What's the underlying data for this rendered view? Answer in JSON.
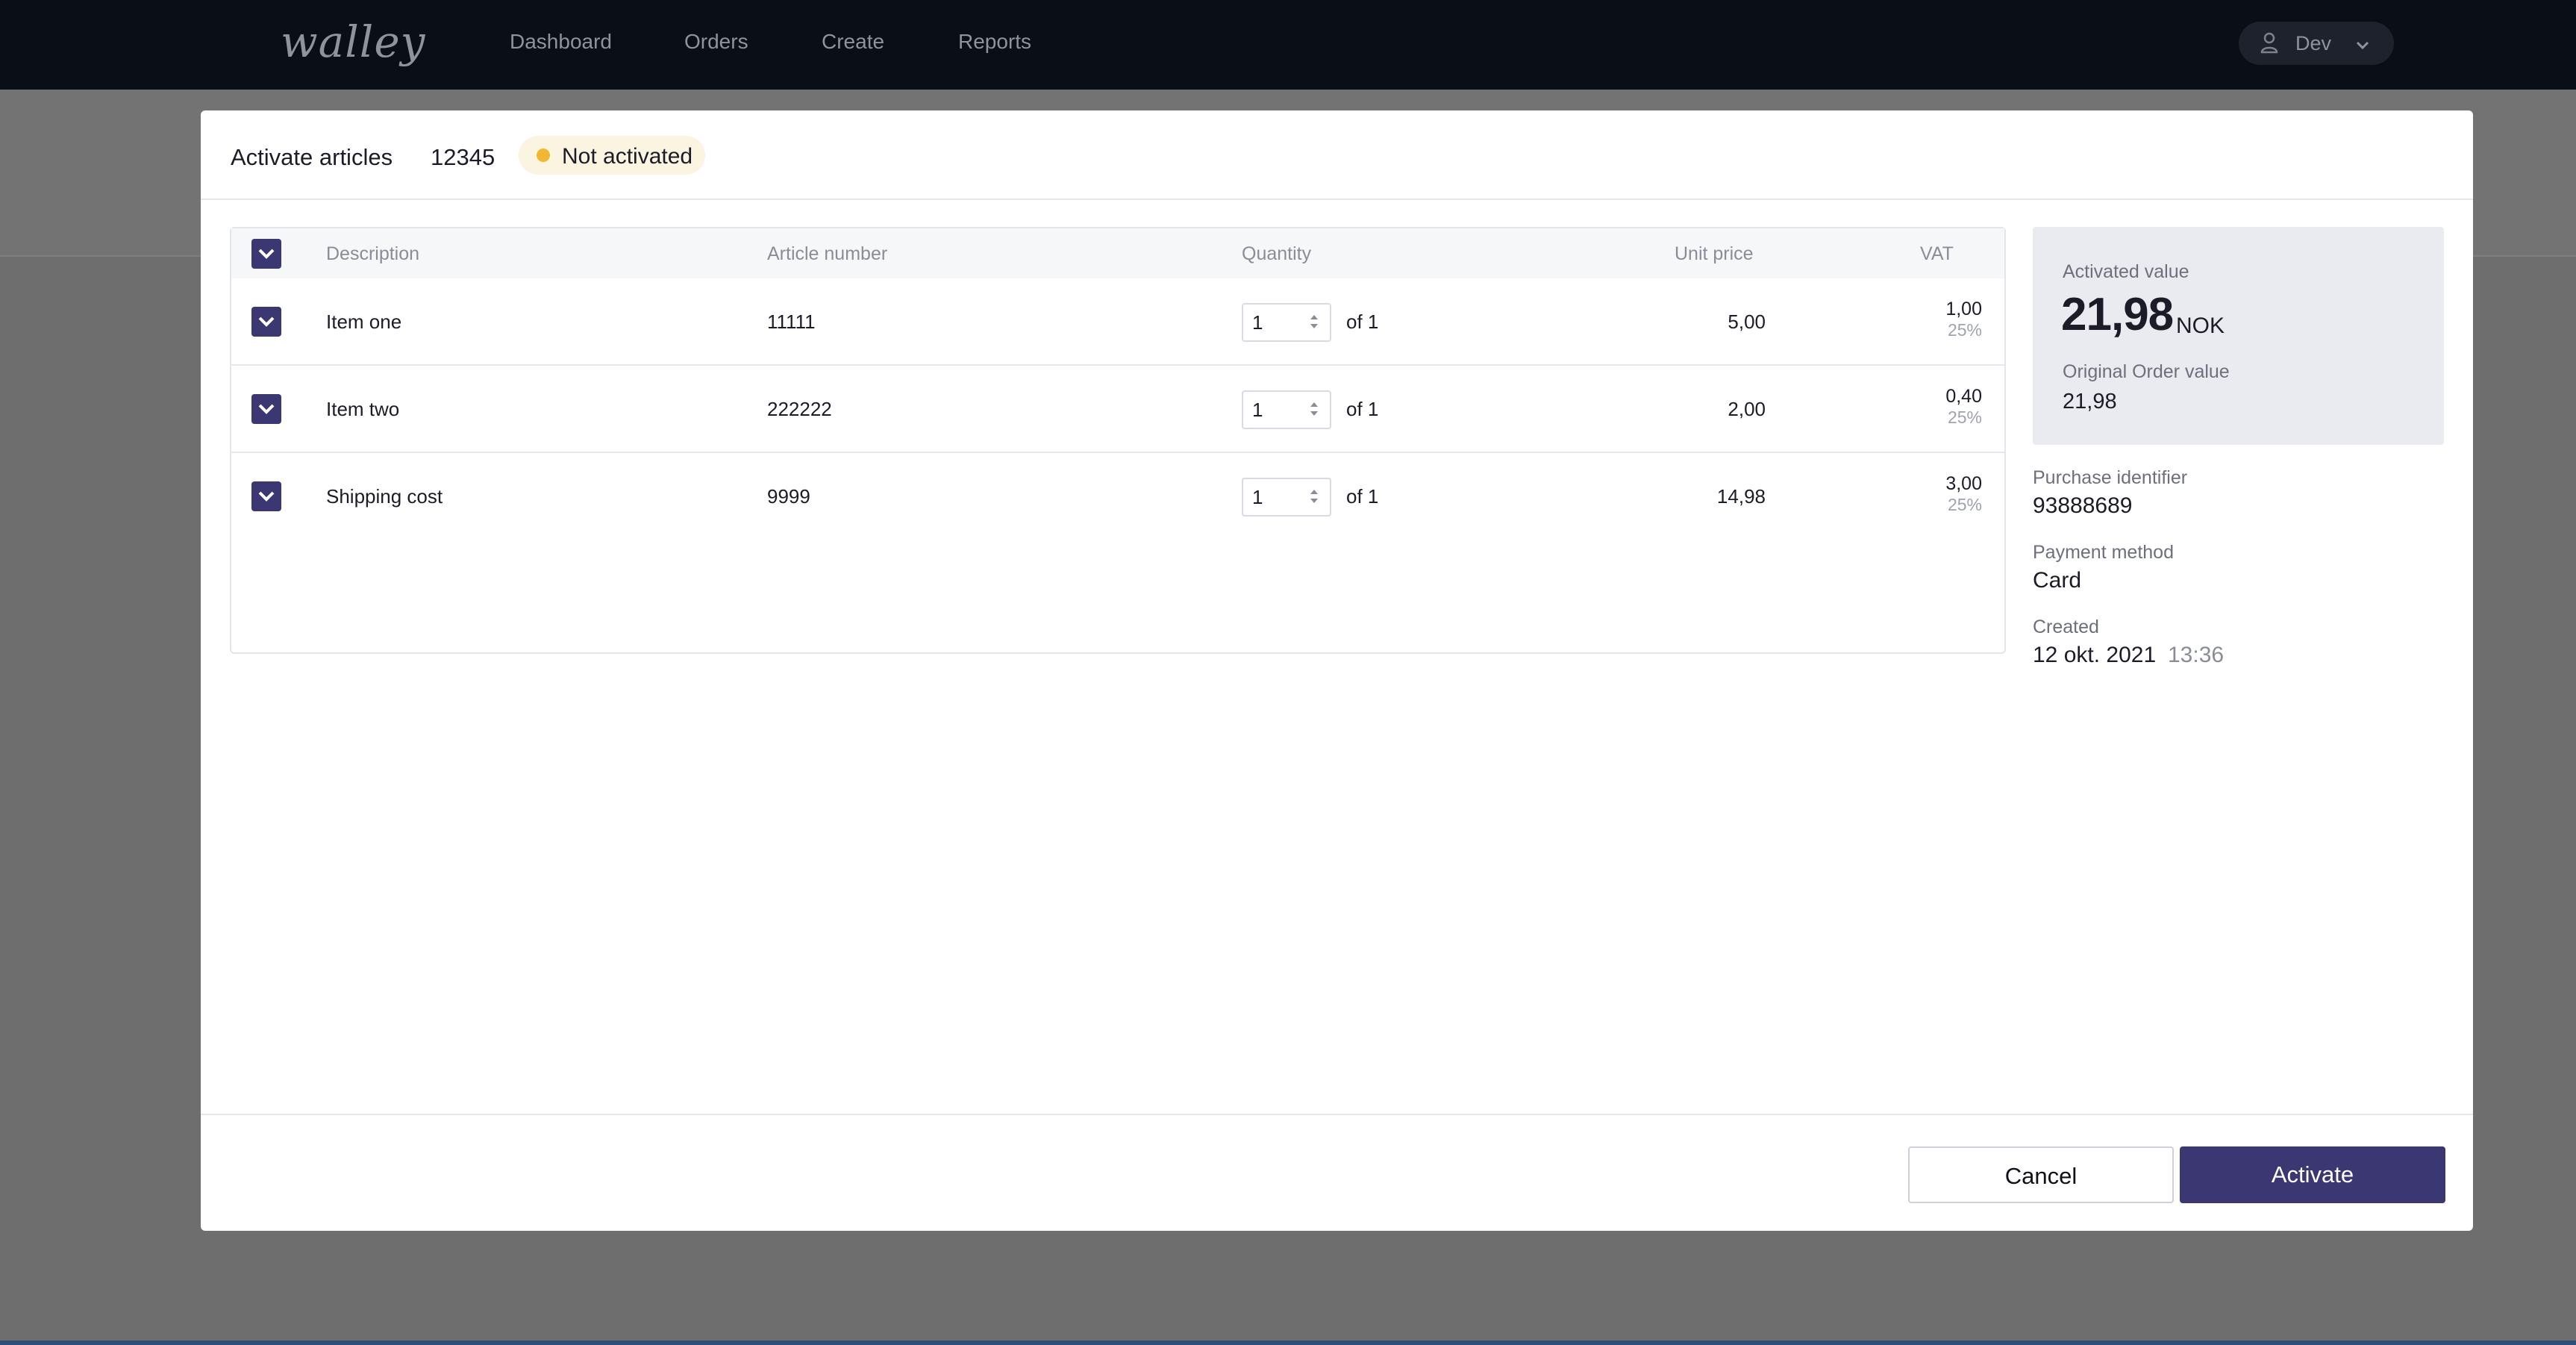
{
  "nav": {
    "logo": "walley",
    "links": [
      "Dashboard",
      "Orders",
      "Create",
      "Reports"
    ],
    "user_name": "Dev"
  },
  "modal": {
    "title": "Activate articles",
    "order_number": "12345",
    "status": "Not activated",
    "columns": {
      "description": "Description",
      "article_number": "Article number",
      "quantity": "Quantity",
      "unit_price": "Unit price",
      "vat": "VAT"
    },
    "rows": [
      {
        "description": "Item one",
        "article_number": "11111",
        "quantity": "1",
        "of": "of 1",
        "unit_price": "5,00",
        "vat": "1,00",
        "vat_rate": "25%"
      },
      {
        "description": "Item two",
        "article_number": "222222",
        "quantity": "1",
        "of": "of 1",
        "unit_price": "2,00",
        "vat": "0,40",
        "vat_rate": "25%"
      },
      {
        "description": "Shipping cost",
        "article_number": "9999",
        "quantity": "1",
        "of": "of 1",
        "unit_price": "14,98",
        "vat": "3,00",
        "vat_rate": "25%"
      }
    ],
    "summary": {
      "activated_label": "Activated value",
      "activated_value": "21,98",
      "currency": "NOK",
      "original_label": "Original Order value",
      "original_value": "21,98"
    },
    "details": {
      "purchase_identifier_label": "Purchase identifier",
      "purchase_identifier": "93888689",
      "payment_method_label": "Payment method",
      "payment_method": "Card",
      "created_label": "Created",
      "created_date": "12 okt. 2021",
      "created_time": "13:36"
    },
    "buttons": {
      "cancel": "Cancel",
      "activate": "Activate"
    }
  },
  "colors": {
    "primary": "#3b3773",
    "status_dot": "#f4b731",
    "status_bg": "#fbf4e1",
    "topbar": "#0a0e17"
  },
  "icons": {
    "user": "person-icon",
    "dropdown": "chevron-down-icon",
    "checkbox": "checkbox-checked-icon",
    "spinner": "number-spinner-icon"
  }
}
